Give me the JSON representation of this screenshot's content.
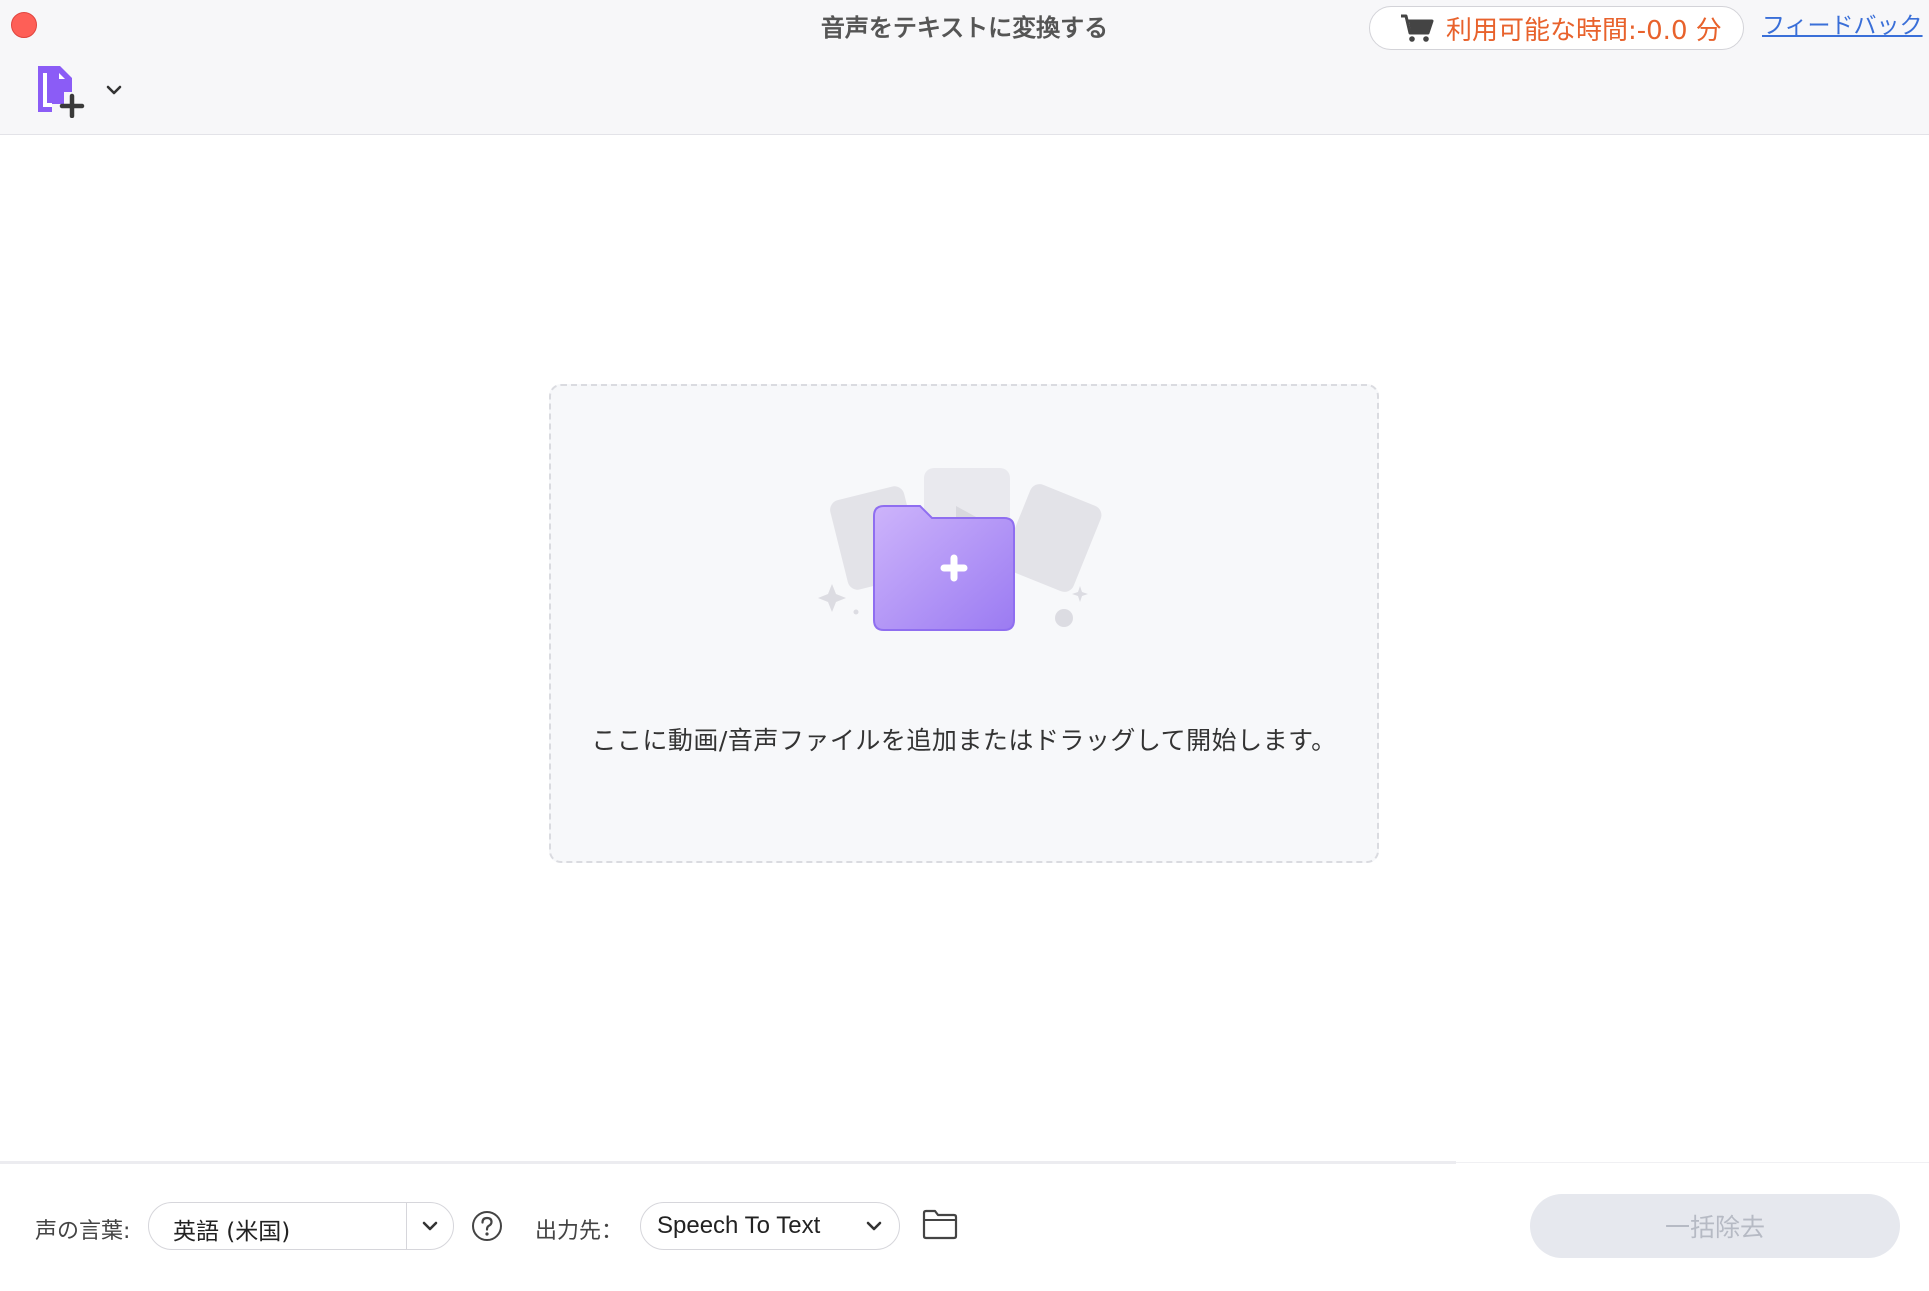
{
  "window": {
    "title": "音声をテキストに変換する"
  },
  "header": {
    "available_time": "利用可能な時間:-0.0 分",
    "feedback_label": "フィードバック",
    "cart_icon": "cart-icon",
    "add_file_icon": "add-file-icon"
  },
  "dropzone": {
    "hint": "ここに動画/音声ファイルを追加またはドラッグして開始します。",
    "illustration_icon": "folder-plus-icon"
  },
  "footer": {
    "language_label": "声の言葉:",
    "language_value": "英語 (米国)",
    "output_label": "出力先：",
    "output_value": "Speech To Text",
    "batch_label": "一括除去",
    "help_icon": "help-icon",
    "folder_icon": "folder-icon"
  },
  "colors": {
    "accent_purple": "#8b5cf6",
    "time_orange": "#e8622c",
    "link_blue": "#3a6fd8",
    "close_red": "#fe5f57"
  }
}
